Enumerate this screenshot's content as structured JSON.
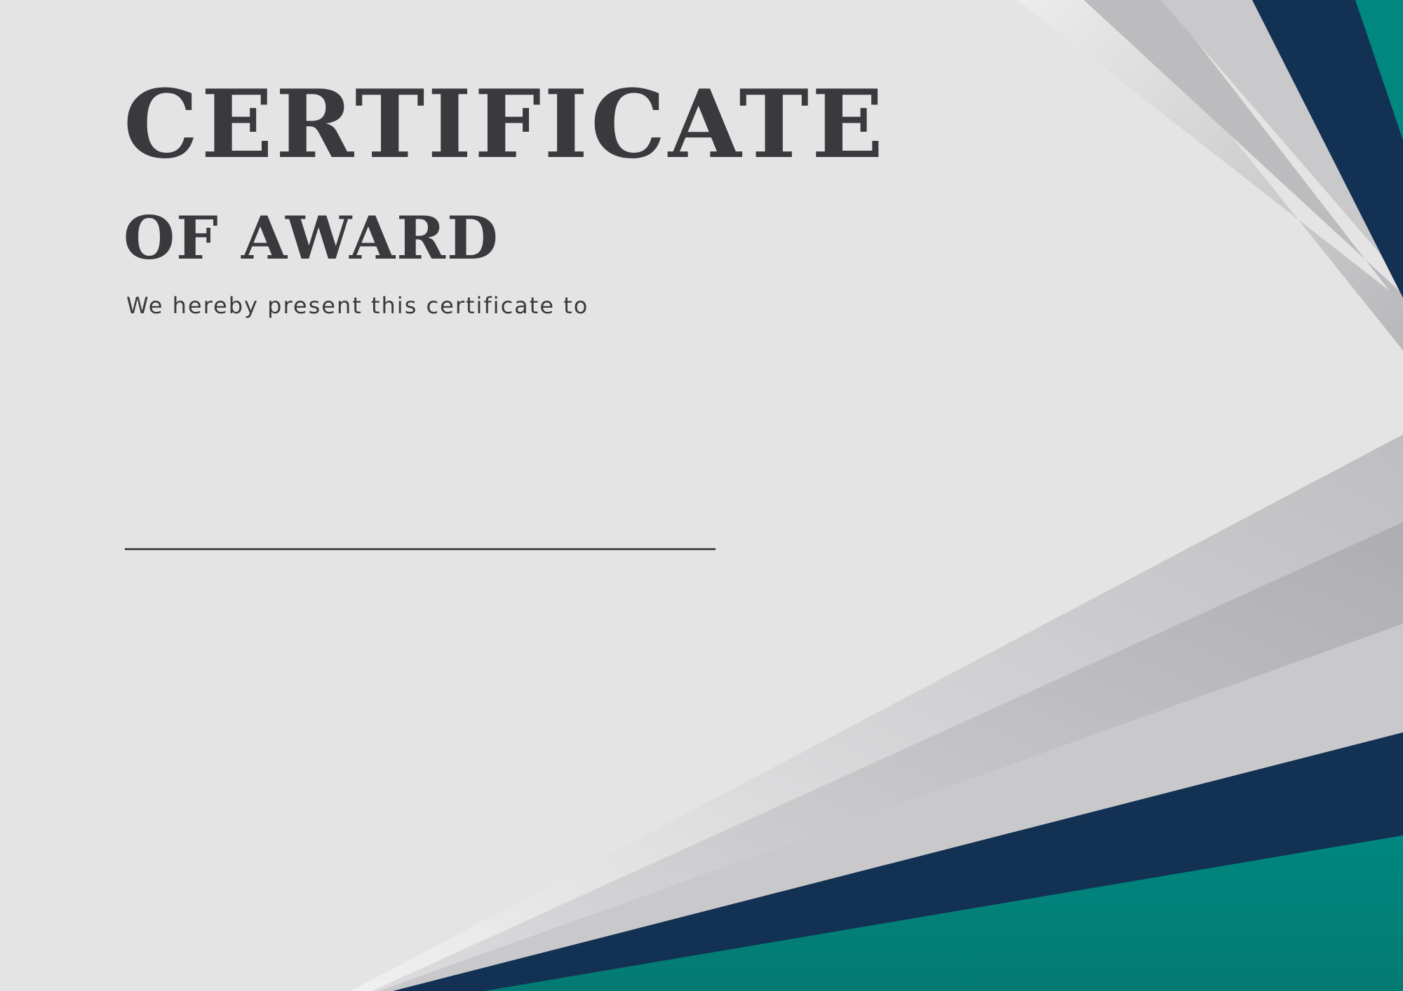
{
  "certificate": {
    "title": "CERTIFICATE",
    "subtitle": "OF AWARD",
    "presented_text": "We hereby present this certificate to"
  },
  "colors": {
    "background": "#e4e4e4",
    "text": "#3a393e",
    "navy": "#133152",
    "teal": "#00877f",
    "silver": "#c8c8ca"
  }
}
